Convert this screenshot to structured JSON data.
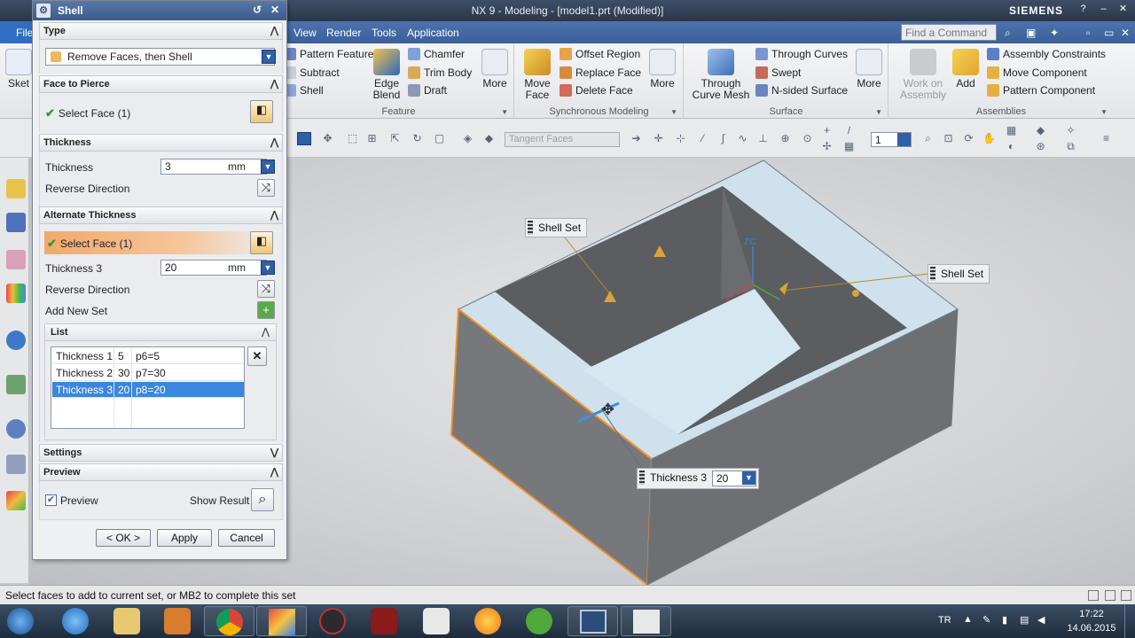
{
  "window": {
    "title": "NX 9 - Modeling - [model1.prt (Modified)]",
    "brand": "SIEMENS",
    "file_menu": "File"
  },
  "menubar": {
    "items": [
      "View",
      "Render",
      "Tools",
      "Application"
    ]
  },
  "command_finder": {
    "placeholder": "Find a Command"
  },
  "ribbon": {
    "feature": {
      "label": "Feature",
      "items": [
        "Pattern Feature",
        "Subtract",
        "Shell"
      ],
      "edge_blend": "Edge Blend",
      "chamfer": "Chamfer",
      "trim_body": "Trim Body",
      "draft": "Draft",
      "more": "More"
    },
    "sync": {
      "label": "Synchronous Modeling",
      "move_face": "Move Face",
      "items": [
        "Offset Region",
        "Replace Face",
        "Delete Face"
      ],
      "more": "More"
    },
    "surface": {
      "label": "Surface",
      "through_curve_mesh": "Through Curve Mesh",
      "items": [
        "Through Curves",
        "Swept",
        "N-sided Surface"
      ],
      "more": "More"
    },
    "assemblies": {
      "label": "Assemblies",
      "work_on_assembly": "Work on Assembly",
      "add": "Add",
      "items": [
        "Assembly Constraints",
        "Move Component",
        "Pattern Component"
      ]
    },
    "sketch_partial": "Sket"
  },
  "toolbar": {
    "selection_filter": "Tangent Faces",
    "layer_value": "1"
  },
  "dialog": {
    "title": "Shell",
    "type_section": "Type",
    "type_value": "Remove Faces, then Shell",
    "face_section": "Face to Pierce",
    "face_select": "Select Face (1)",
    "thickness_section": "Thickness",
    "thickness_label": "Thickness",
    "thickness_value": "3",
    "unit": "mm",
    "reverse_direction": "Reverse Direction",
    "alt_section": "Alternate Thickness",
    "alt_select": "Select Face (1)",
    "alt_thickness_label": "Thickness 3",
    "alt_thickness_value": "20",
    "add_new_set": "Add New Set",
    "list_section": "List",
    "list_rows": [
      {
        "name": "Thickness 1",
        "value": "5",
        "expr": "p6=5"
      },
      {
        "name": "Thickness 2",
        "value": "30",
        "expr": "p7=30"
      },
      {
        "name": "Thickness 3",
        "value": "20",
        "expr": "p8=20"
      }
    ],
    "settings_section": "Settings",
    "preview_section": "Preview",
    "preview_label": "Preview",
    "show_result": "Show Result",
    "ok": "< OK >",
    "apply": "Apply",
    "cancel": "Cancel"
  },
  "viewport": {
    "callout_shell_set_1": "Shell Set",
    "callout_shell_set_2": "Shell Set",
    "callout_thickness_label": "Thickness 3",
    "callout_thickness_value": "20",
    "axis_label": "ZC"
  },
  "status": {
    "message": "Select faces to add to current set, or MB2 to complete this set"
  },
  "taskbar": {
    "language": "TR",
    "time": "17:22",
    "date": "14.06.2015"
  },
  "colors": {
    "accent": "#3b86df",
    "menubar": "#4066a1",
    "highlight_edge": "#f0902c"
  }
}
